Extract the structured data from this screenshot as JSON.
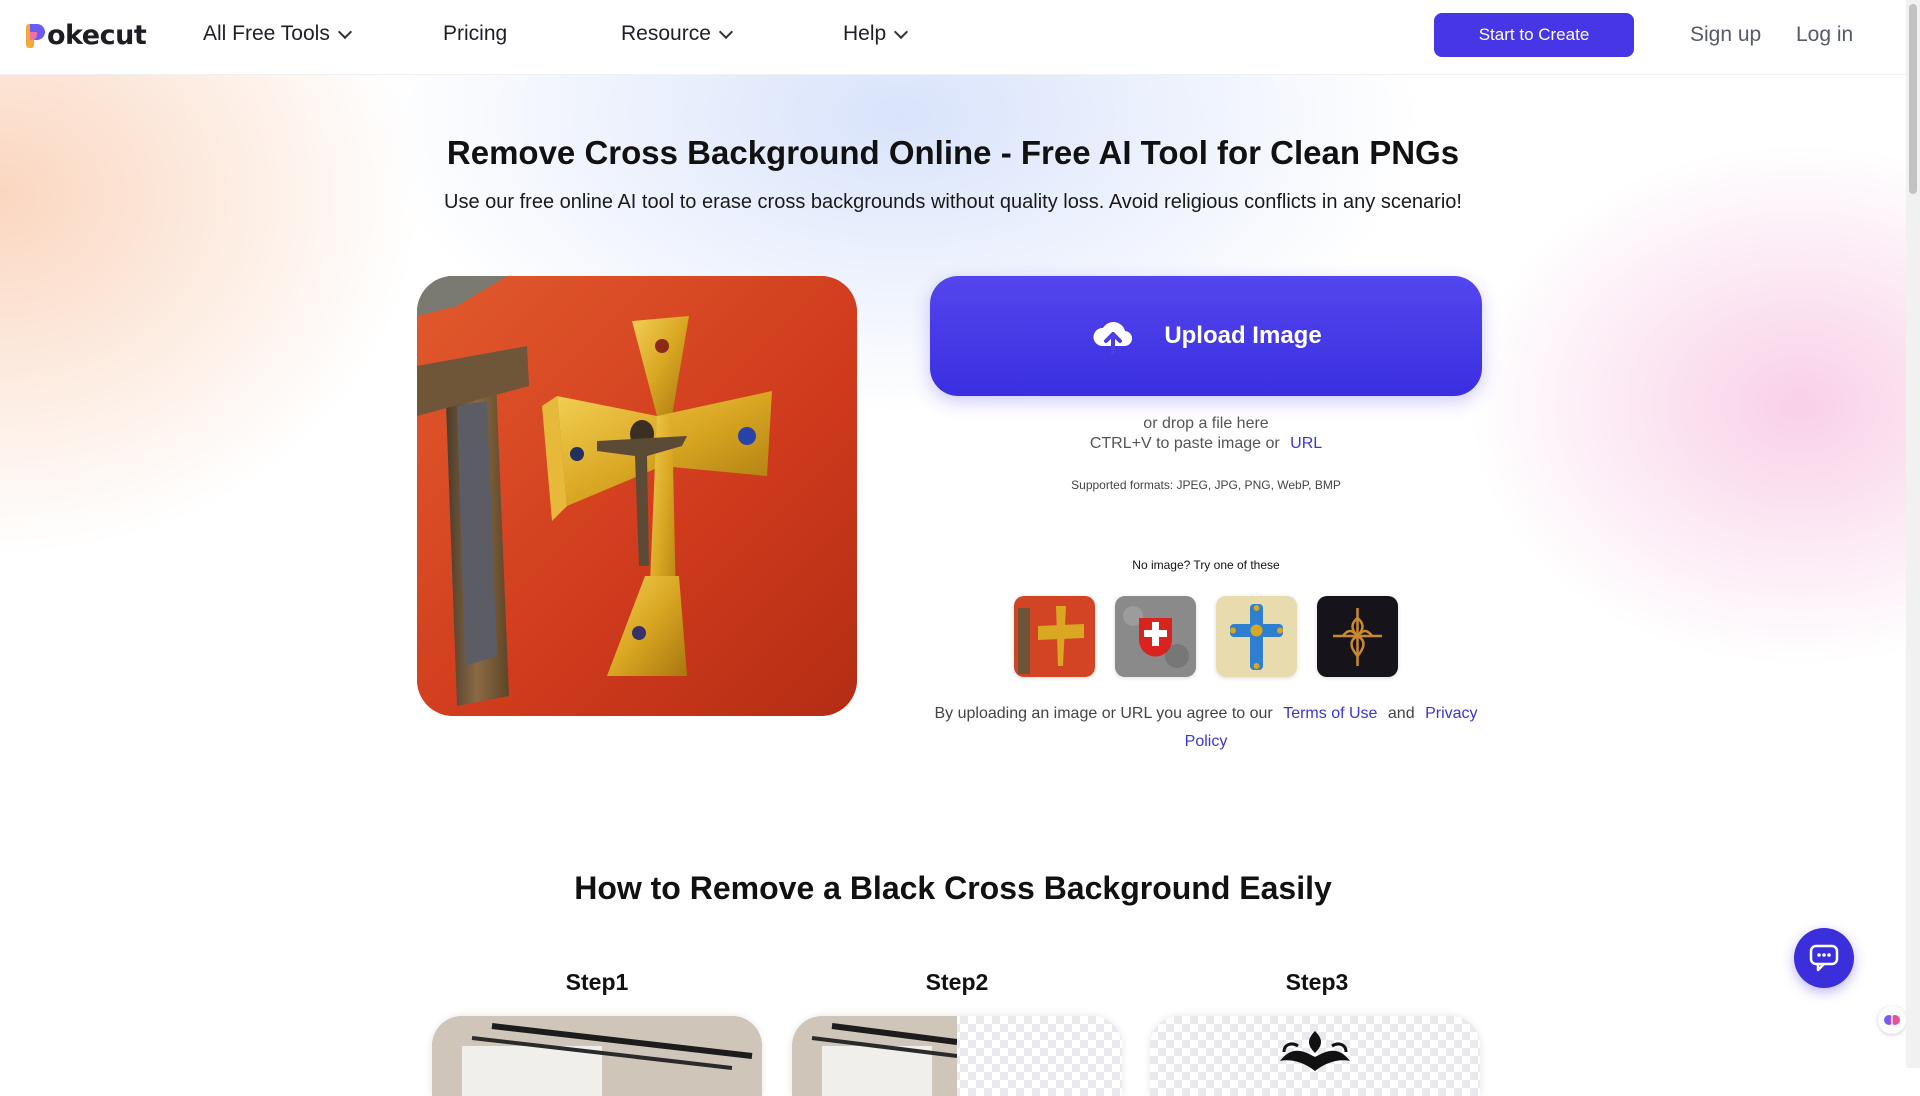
{
  "nav": {
    "logo_text": "okecut",
    "all_tools": "All Free Tools",
    "pricing": "Pricing",
    "resource": "Resource",
    "help": "Help",
    "start_button": "Start to Create",
    "sign_up": "Sign up",
    "log_in": "Log in"
  },
  "hero": {
    "title": "Remove Cross Background Online - Free AI Tool for Clean PNGs",
    "subtitle": "Use our free online AI tool to erase cross backgrounds without quality loss. Avoid religious conflicts in any scenario!"
  },
  "upload": {
    "button_label": "Upload Image",
    "drop_hint": "or drop a file here",
    "paste_hint": "CTRL+V to paste image or",
    "url_link": "URL",
    "formats": "Supported formats: JPEG, JPG, PNG, WebP, BMP",
    "try_label": "No image? Try one of these",
    "samples": [
      {
        "icon": "gold-crucifix-sample"
      },
      {
        "icon": "swiss-cross-sample"
      },
      {
        "icon": "blue-cross-sample"
      },
      {
        "icon": "ornate-black-cross-sample"
      }
    ],
    "terms_prefix": "By uploading an image or URL you agree to our",
    "terms_link": "Terms of Use",
    "terms_and": "and",
    "privacy_link_1": "Privacy",
    "privacy_link_2": "Policy"
  },
  "how_to": {
    "title": "How to Remove a Black Cross Background Easily",
    "steps": [
      {
        "label": "Step1"
      },
      {
        "label": "Step2"
      },
      {
        "label": "Step3"
      }
    ]
  },
  "colors": {
    "accent": "#4636e6",
    "link": "#3b34d6",
    "preview_bg": "#d5401f"
  }
}
